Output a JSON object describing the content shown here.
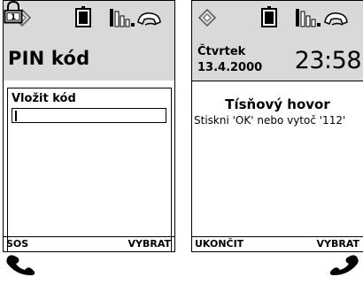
{
  "pin_screen": {
    "title": "PIN kód",
    "input_label": "Vložit kód",
    "input_value": "",
    "softkey_left": "SOS",
    "softkey_right": "VYBRAT"
  },
  "emergency_screen": {
    "day": "Čtvrtek",
    "date": "13.4.2000",
    "time": "23:58",
    "heading": "Tísňový hovor",
    "message": "Stiskni 'OK' nebo vytoč '112'",
    "softkey_left": "UKONČIT",
    "softkey_right": "VYBRAT"
  },
  "icons": [
    "diamond-icon",
    "battery-icon",
    "signal-bars-icon",
    "handset-ring-icon",
    "padlock-icon",
    "handset-icon"
  ]
}
